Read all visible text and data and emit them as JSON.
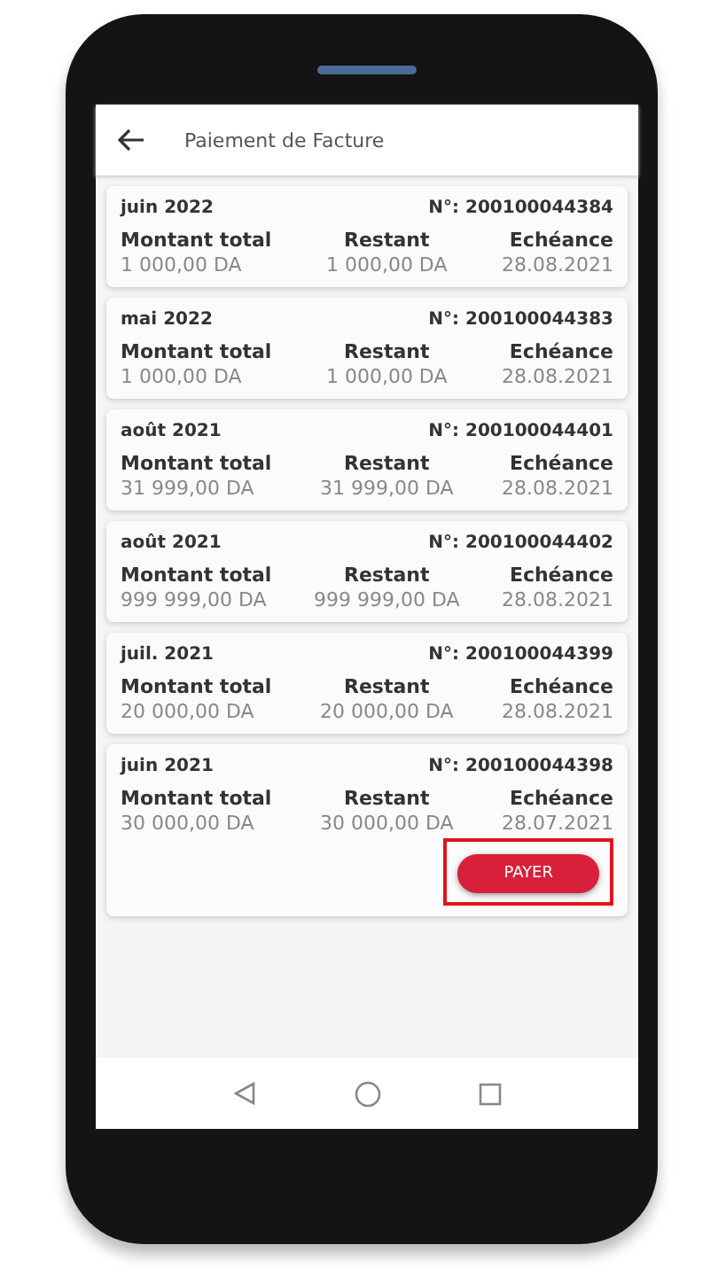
{
  "header": {
    "title": "Paiement de Facture"
  },
  "invoices": [
    {
      "period": "juin 2022",
      "number": "N°: 200100044384",
      "fields": [
        {
          "label": "Montant total",
          "value": "1 000,00 DA"
        },
        {
          "label": "Restant",
          "value": "1 000,00 DA"
        },
        {
          "label": "Echéance",
          "value": "28.08.2021"
        }
      ]
    },
    {
      "period": "mai 2022",
      "number": "N°: 200100044383",
      "fields": [
        {
          "label": "Montant total",
          "value": "1 000,00 DA"
        },
        {
          "label": "Restant",
          "value": "1 000,00 DA"
        },
        {
          "label": "Echéance",
          "value": "28.08.2021"
        }
      ]
    },
    {
      "period": "août 2021",
      "number": "N°: 200100044401",
      "fields": [
        {
          "label": "Montant total",
          "value": "31 999,00 DA"
        },
        {
          "label": "Restant",
          "value": "31 999,00 DA"
        },
        {
          "label": "Echéance",
          "value": "28.08.2021"
        }
      ]
    },
    {
      "period": "août 2021",
      "number": "N°: 200100044402",
      "fields": [
        {
          "label": "Montant total",
          "value": "999 999,00 DA"
        },
        {
          "label": "Restant",
          "value": "999 999,00 DA"
        },
        {
          "label": "Echéance",
          "value": "28.08.2021"
        }
      ]
    },
    {
      "period": "juil. 2021",
      "number": "N°: 200100044399",
      "fields": [
        {
          "label": "Montant total",
          "value": "20 000,00 DA"
        },
        {
          "label": "Restant",
          "value": "20 000,00 DA"
        },
        {
          "label": "Echéance",
          "value": "28.08.2021"
        }
      ]
    },
    {
      "period": "juin 2021",
      "number": "N°: 200100044398",
      "fields": [
        {
          "label": "Montant total",
          "value": "30 000,00 DA"
        },
        {
          "label": "Restant",
          "value": "30 000,00 DA"
        },
        {
          "label": "Echéance",
          "value": "28.07.2021"
        }
      ],
      "pay_button": {
        "label": "PAYER",
        "highlighted": true
      }
    }
  ]
}
